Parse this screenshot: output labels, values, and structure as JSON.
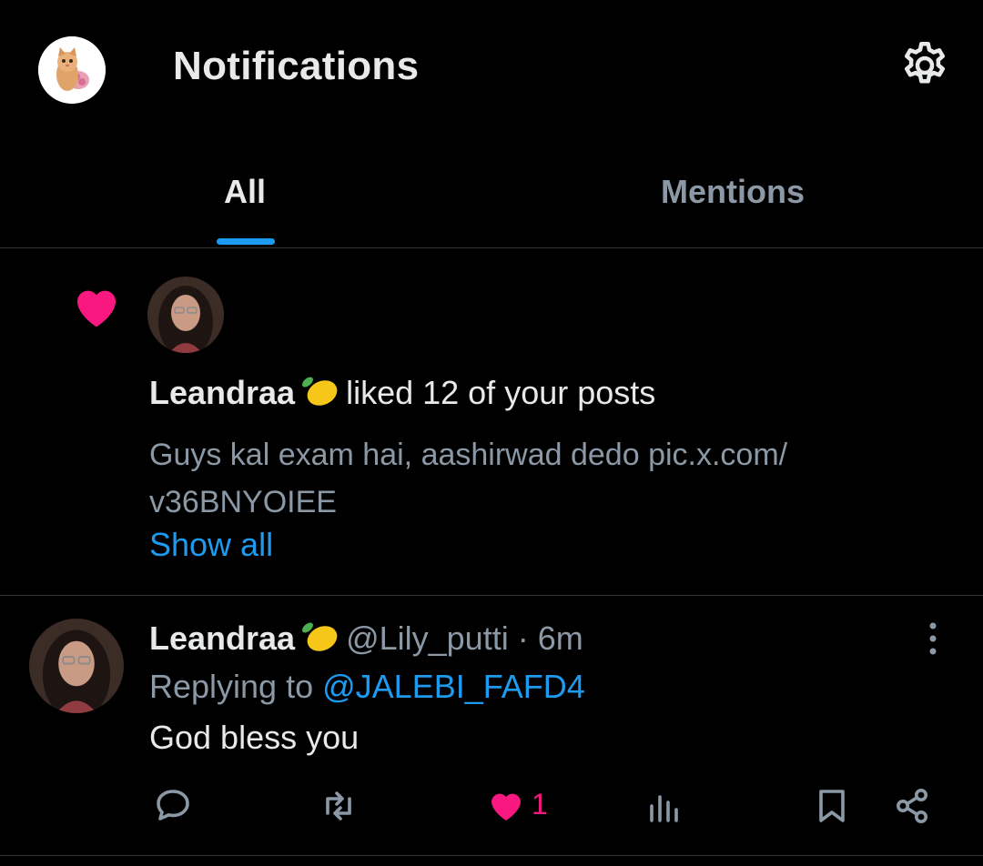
{
  "header": {
    "title": "Notifications",
    "profile_icon": "kitten-avatar",
    "settings_icon": "gear-icon"
  },
  "tabs": [
    {
      "label": "All",
      "active": true
    },
    {
      "label": "Mentions",
      "active": false
    }
  ],
  "like_notification": {
    "icon": "heart-icon",
    "user_name": "Leandraa",
    "emoji": "lemon",
    "action_text": "liked 12 of your posts",
    "post_preview": "Guys kal exam hai, aashirwad dedo pic.x.com/ v36BNYOIEE",
    "show_all": "Show all"
  },
  "reply": {
    "user_name": "Leandraa",
    "emoji": "lemon",
    "handle": "@Lily_putti",
    "separator": "·",
    "time": "6m",
    "replying_label": "Replying to",
    "replying_handle": "@JALEBI_FAFD4",
    "text": "God bless you",
    "like_count": "1"
  },
  "colors": {
    "background": "#000000",
    "text_primary": "#e7e9ea",
    "text_secondary": "#8b98a5",
    "accent": "#1d9bf0",
    "like": "#f91880",
    "divider": "#2f3336"
  }
}
